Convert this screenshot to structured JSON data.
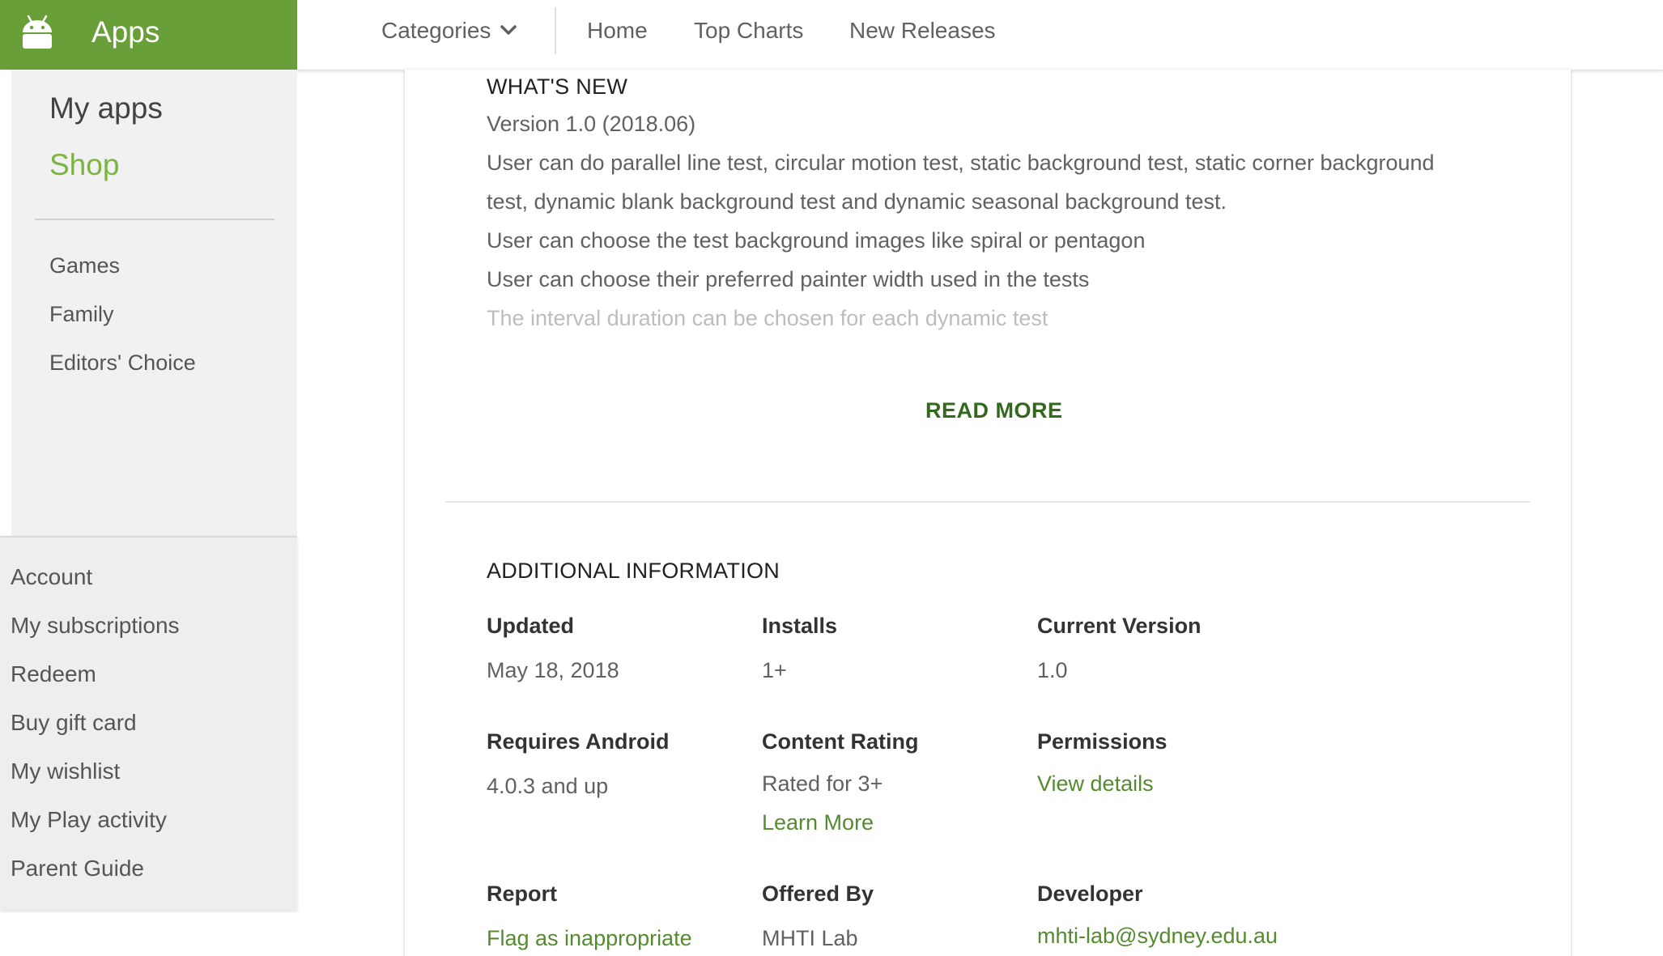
{
  "brand": {
    "label": "Apps",
    "color": "#689f38",
    "icon": "android-icon"
  },
  "nav": {
    "categories": "Categories",
    "home": "Home",
    "top_charts": "Top Charts",
    "new_releases": "New Releases"
  },
  "sidebar": {
    "my_apps": "My apps",
    "shop": "Shop",
    "categories": [
      "Games",
      "Family",
      "Editors' Choice"
    ],
    "account_links": [
      "Account",
      "My subscriptions",
      "Redeem",
      "Buy gift card",
      "My wishlist",
      "My Play activity",
      "Parent Guide"
    ]
  },
  "whats_new": {
    "title": "WHAT'S NEW",
    "lines": [
      "Version 1.0 (2018.06)",
      "User can do parallel line test, circular motion test, static background test, static corner background",
      "test, dynamic blank background test and dynamic seasonal background test.",
      "User can choose the test background images like spiral or pentagon",
      "User can choose their preferred painter width used in the tests",
      "The interval duration can be chosen for each dynamic test"
    ],
    "read_more": "READ MORE"
  },
  "additional_info": {
    "title": "ADDITIONAL INFORMATION",
    "updated": {
      "label": "Updated",
      "value": "May 18, 2018"
    },
    "installs": {
      "label": "Installs",
      "value": "1+"
    },
    "current_version": {
      "label": "Current Version",
      "value": "1.0"
    },
    "requires_android": {
      "label": "Requires Android",
      "value": "4.0.3 and up"
    },
    "content_rating": {
      "label": "Content Rating",
      "value": "Rated for 3+",
      "link": "Learn More"
    },
    "permissions": {
      "label": "Permissions",
      "link": "View details"
    },
    "report": {
      "label": "Report",
      "link": "Flag as inappropriate"
    },
    "offered_by": {
      "label": "Offered By",
      "value": "MHTI Lab"
    },
    "developer": {
      "label": "Developer",
      "email": "mhti-lab@sydney.edu.au"
    }
  },
  "colors": {
    "accent_green": "#689f38",
    "shop_green": "#7cb342",
    "link_green": "#558b2f",
    "read_more_green": "#33691e"
  }
}
